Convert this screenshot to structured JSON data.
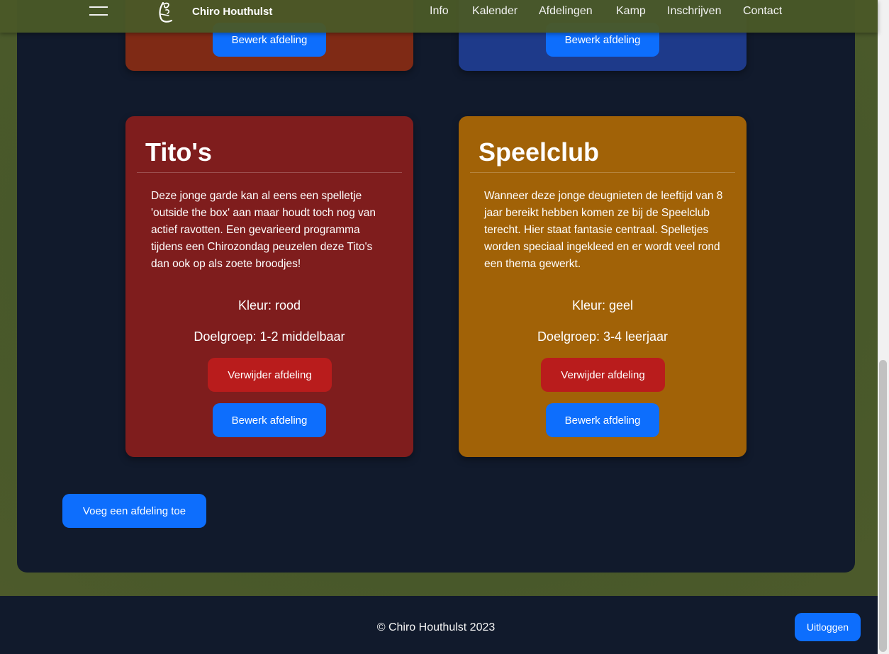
{
  "navbar": {
    "brand": "Chiro Houthulst",
    "links": [
      "Info",
      "Kalender",
      "Afdelingen",
      "Kamp",
      "Inschrijven",
      "Contact"
    ]
  },
  "cards_top": [
    {
      "button_edit": "Bewerk afdeling",
      "color": "#7f2a15"
    },
    {
      "button_edit": "Bewerk afdeling",
      "color": "#1e3a8a"
    }
  ],
  "cards": [
    {
      "title": "Tito's",
      "description": "Deze jonge garde kan al eens een spelletje 'outside the box' aan maar houdt toch nog van actief ravotten. Een gevarieerd programma tijdens een Chirozondag peuzelen deze Tito's dan ook op als zoete broodjes!",
      "kleur": "Kleur: rood",
      "doelgroep": "Doelgroep: 1-2 middelbaar",
      "button_delete": "Verwijder afdeling",
      "button_edit": "Bewerk afdeling",
      "color": "#7f1d1d"
    },
    {
      "title": "Speelclub",
      "description": "Wanneer deze jonge deugnieten de leeftijd van 8 jaar bereikt hebben komen ze bij de Speelclub terecht. Hier staat fantasie centraal. Spelletjes worden speciaal ingekleed en er wordt veel rond een thema gewerkt.",
      "kleur": "Kleur: geel",
      "doelgroep": "Doelgroep: 3-4 leerjaar",
      "button_delete": "Verwijder afdeling",
      "button_edit": "Bewerk afdeling",
      "color": "#a16207"
    }
  ],
  "add_button": "Voeg een afdeling toe",
  "footer": {
    "copyright": "© Chiro Houthulst 2023",
    "logout": "Uitloggen"
  },
  "colors": {
    "accent_blue": "#0d6efd",
    "danger_red": "#b91c1c",
    "panel": "#111a2c"
  }
}
